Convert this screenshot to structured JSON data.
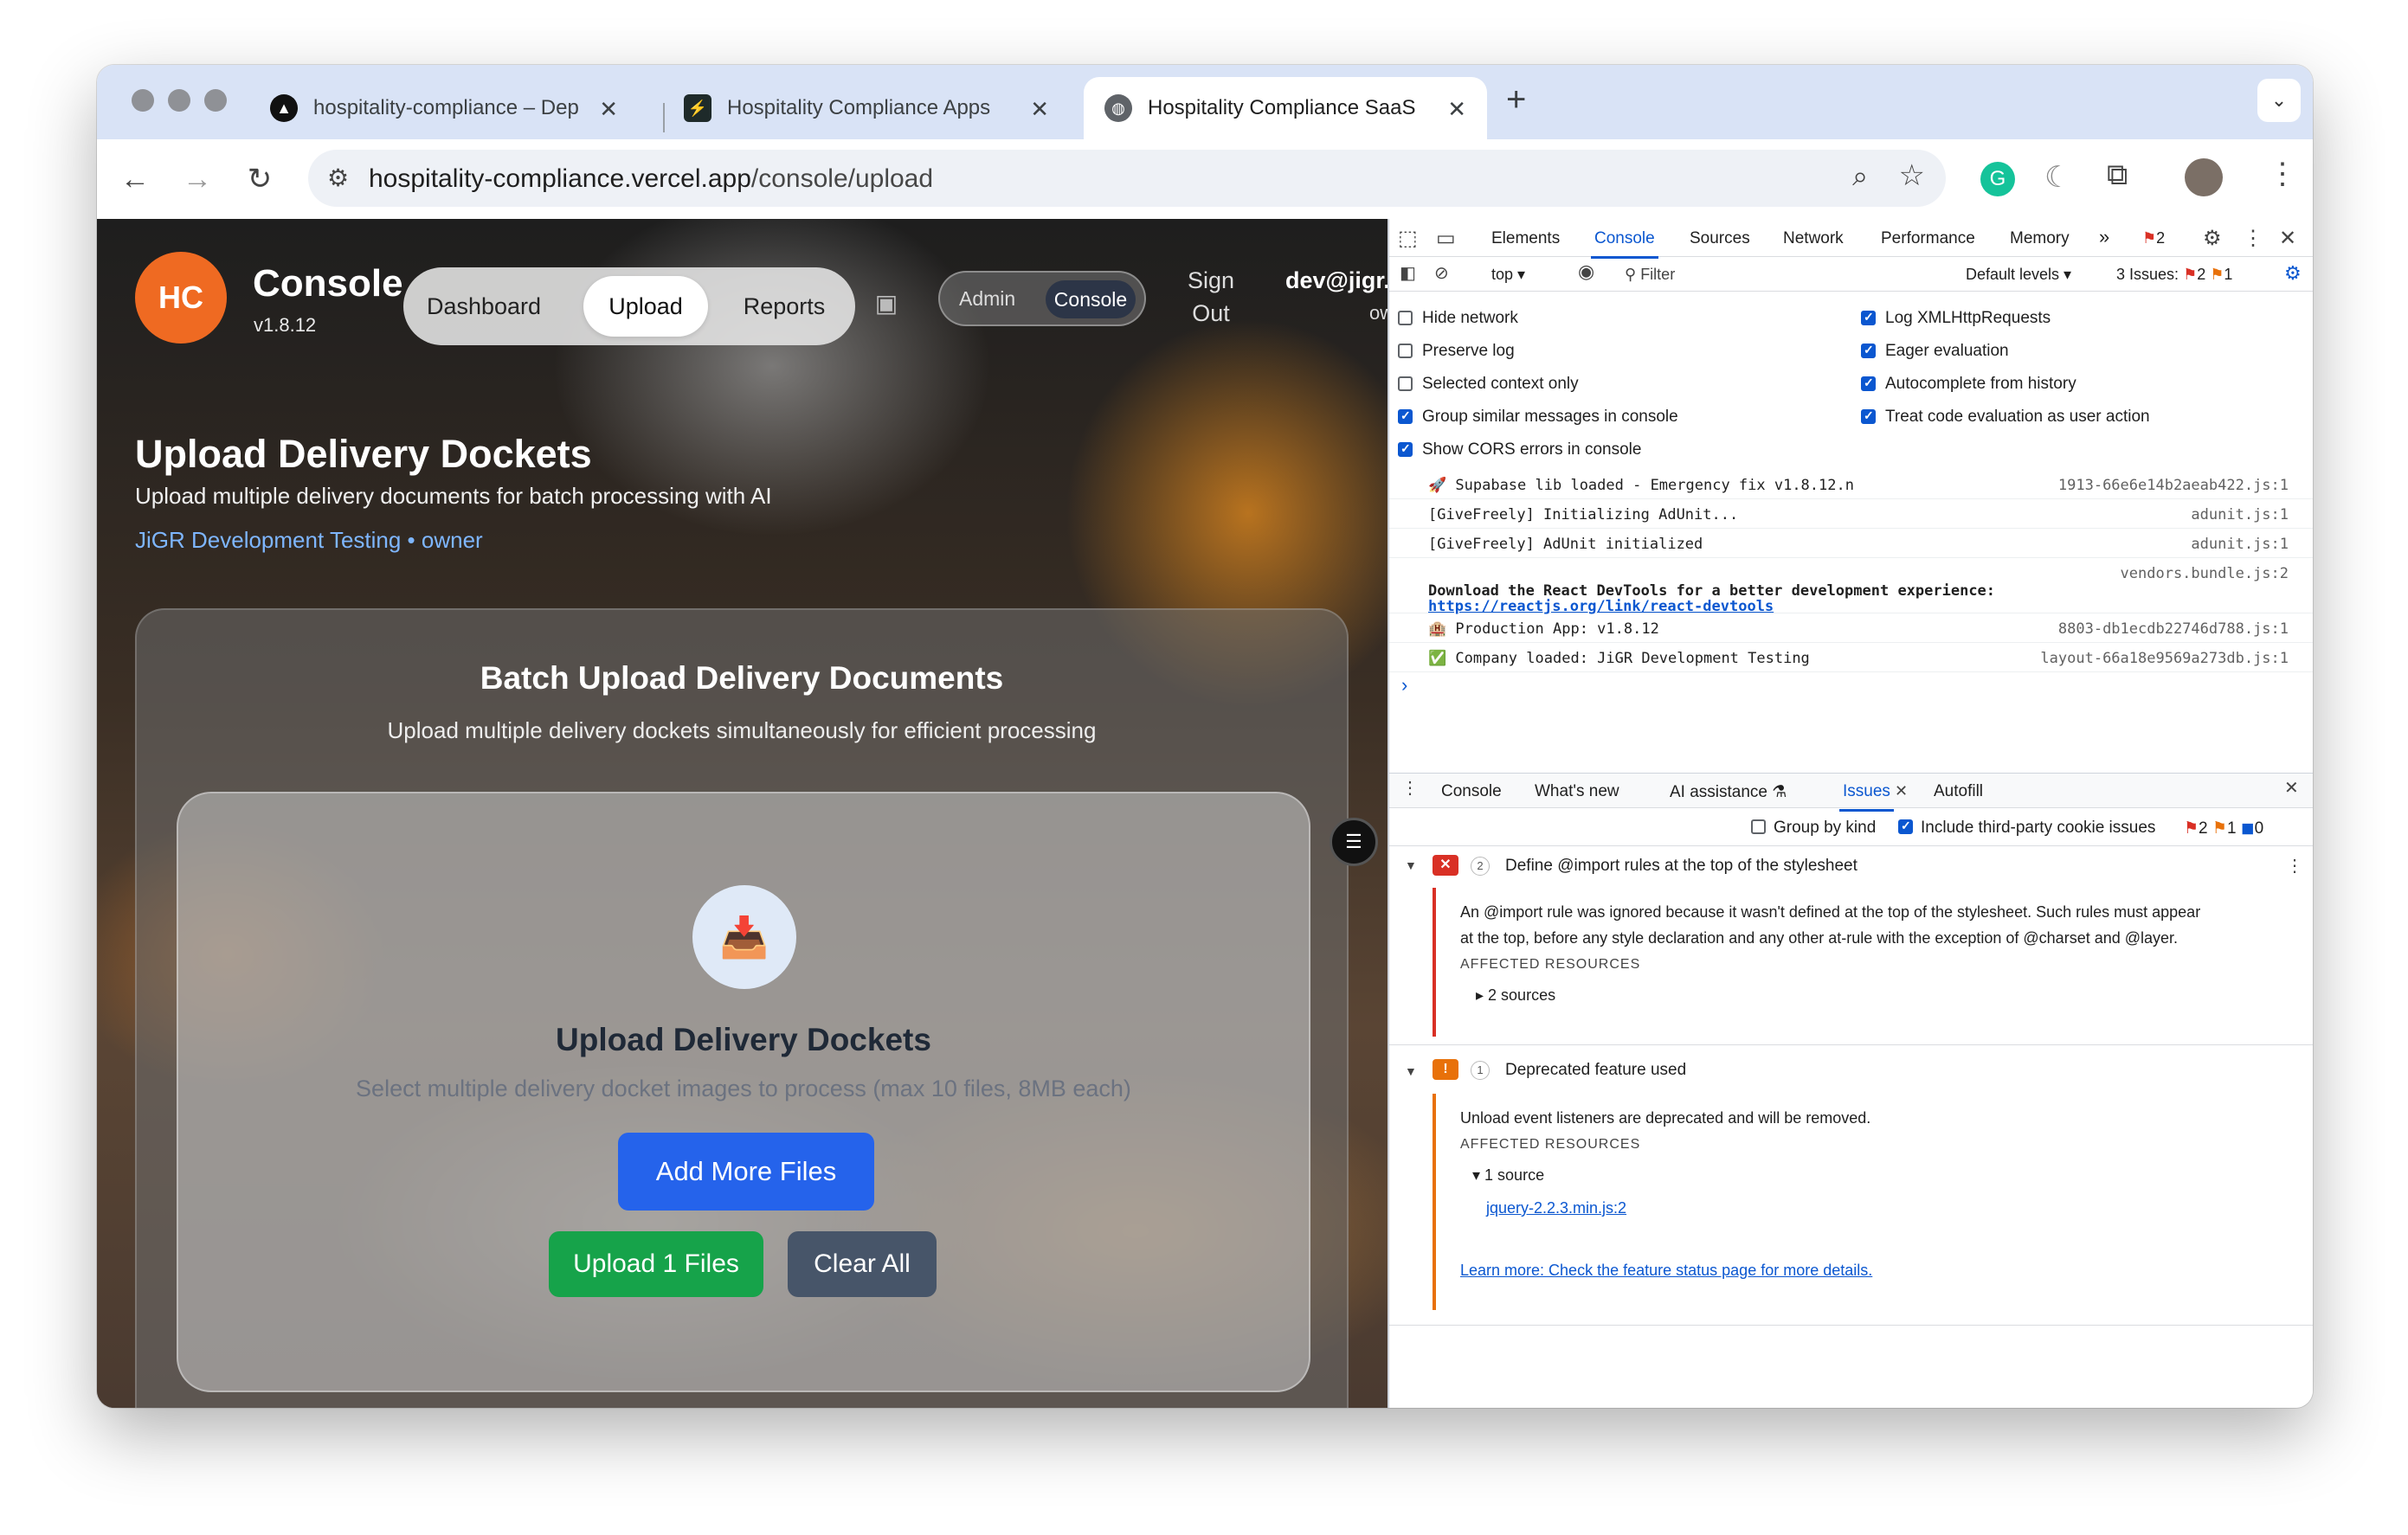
{
  "browser": {
    "tabs": [
      {
        "title": "hospitality-compliance – Dep",
        "active": false
      },
      {
        "title": "Hospitality Compliance Apps",
        "active": false
      },
      {
        "title": "Hospitality Compliance SaaS",
        "active": true
      }
    ],
    "new_tab": "+",
    "url_host": "hospitality-compliance.vercel.app",
    "url_path": "/console/upload"
  },
  "site": {
    "logo": "HC",
    "brand": "Console",
    "version": "v1.8.12",
    "nav": [
      "Dashboard",
      "Upload",
      "Reports"
    ],
    "mode": {
      "admin": "Admin",
      "console": "Console"
    },
    "signout1": "Sign",
    "signout2": "Out",
    "email": "dev@jigr.a",
    "email_sub": "ow",
    "title": "Upload Delivery Dockets",
    "subtitle": "Upload multiple delivery documents for batch processing with AI",
    "org": "JiGR Development Testing • owner",
    "card": {
      "title": "Batch Upload Delivery Documents",
      "subtitle": "Upload multiple delivery dockets simultaneously for efficient processing",
      "upload_title": "Upload Delivery Dockets",
      "upload_hint": "Select multiple delivery docket images to process (max 10 files, 8MB each)",
      "add_more": "Add More Files",
      "upload": "Upload 1 Files",
      "clear": "Clear All"
    }
  },
  "devtools": {
    "tabs": [
      "Elements",
      "Console",
      "Sources",
      "Network",
      "Performance",
      "Memory"
    ],
    "more": "»",
    "errors": "2",
    "context": "top ▾",
    "filter": "Filter",
    "levels": "Default levels ▾",
    "issues_label": "3 Issues:",
    "issues_err": "2",
    "issues_warn": "1",
    "options_left": [
      {
        "label": "Hide network",
        "on": false
      },
      {
        "label": "Preserve log",
        "on": false
      },
      {
        "label": "Selected context only",
        "on": false
      },
      {
        "label": "Group similar messages in console",
        "on": true
      },
      {
        "label": "Show CORS errors in console",
        "on": true
      }
    ],
    "options_right": [
      {
        "label": "Log XMLHttpRequests",
        "on": true
      },
      {
        "label": "Eager evaluation",
        "on": true
      },
      {
        "label": "Autocomplete from history",
        "on": true
      },
      {
        "label": "Treat code evaluation as user action",
        "on": true
      }
    ],
    "logs": [
      {
        "msg": "🚀 Supabase lib loaded - Emergency fix v1.8.12.n",
        "src": "1913-66e6e14b2aeab422.js:1"
      },
      {
        "msg": "[GiveFreely] Initializing AdUnit...",
        "src": "adunit.js:1"
      },
      {
        "msg": "[GiveFreely] AdUnit initialized",
        "src": "adunit.js:1"
      },
      {
        "msg": "",
        "src": "vendors.bundle.js:2"
      },
      {
        "msg": "🏨 Production App: v1.8.12",
        "src": "8803-db1ecdb22746d788.js:1"
      },
      {
        "msg": "✅ Company loaded: JiGR Development Testing",
        "src": "layout-66a18e9569a273db.js:1"
      }
    ],
    "react_msg": "Download the React DevTools for a better development experience:",
    "react_link": "https://reactjs.org/link/react-devtools",
    "prompt": "›",
    "drawer": {
      "tabs": [
        "Console",
        "What's new",
        "AI assistance ⚗",
        "Issues",
        "Autofill"
      ],
      "group_by_kind": "Group by kind",
      "third_party": "Include third-party cookie issues",
      "counts": {
        "err": "2",
        "warn": "1",
        "info": "0"
      },
      "issue1": {
        "count": "2",
        "title": "Define @import rules at the top of the stylesheet",
        "body1": "An @import rule was ignored because it wasn't defined at the top of the stylesheet. Such rules must appear",
        "body2": "at the top, before any style declaration and any other at-rule with the exception of @charset and @layer.",
        "affected": "AFFECTED RESOURCES",
        "sources": "▸ 2 sources"
      },
      "issue2": {
        "count": "1",
        "title": "Deprecated feature used",
        "body": "Unload event listeners are deprecated and will be removed.",
        "affected": "AFFECTED RESOURCES",
        "sources": "▾ 1 source",
        "file": "jquery-2.2.3.min.js:2",
        "learn": "Learn more: Check the feature status page for more details."
      }
    }
  },
  "colors": {
    "accent": "#0b57d0",
    "orange": "#ef6a22",
    "green": "#16a34a",
    "blue": "#2563eb",
    "slate": "#475569",
    "error": "#d93025",
    "warn": "#e8710a"
  }
}
